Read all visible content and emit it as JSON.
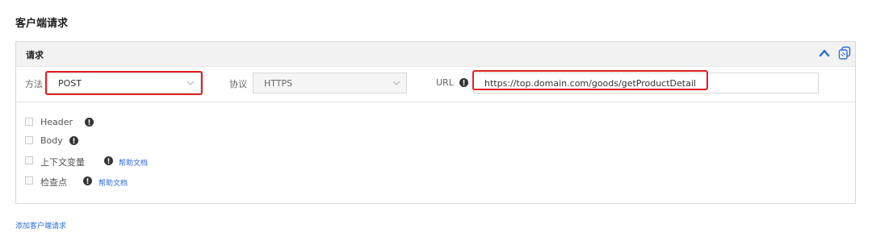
{
  "section": {
    "title": "客户端请求"
  },
  "panel": {
    "title": "请求"
  },
  "request": {
    "method_label": "方法",
    "method_value": "POST",
    "protocol_label": "协议",
    "protocol_value": "HTTPS",
    "url_label": "URL",
    "url_value": "https://top.domain.com/goods/getProductDetail"
  },
  "options": [
    {
      "label": "Header"
    },
    {
      "label": "Body"
    },
    {
      "label": "上下文变量",
      "help": "帮助文档"
    },
    {
      "label": "检查点",
      "help": "帮助文档"
    }
  ],
  "footer": {
    "add_link": "添加客户端请求"
  },
  "colors": {
    "accent": "#2a6bd6",
    "highlight": "#e02020",
    "icon": "#333333"
  },
  "icons": [
    "chevron-up-icon",
    "copy-icon",
    "chevron-down-icon",
    "info-icon"
  ]
}
